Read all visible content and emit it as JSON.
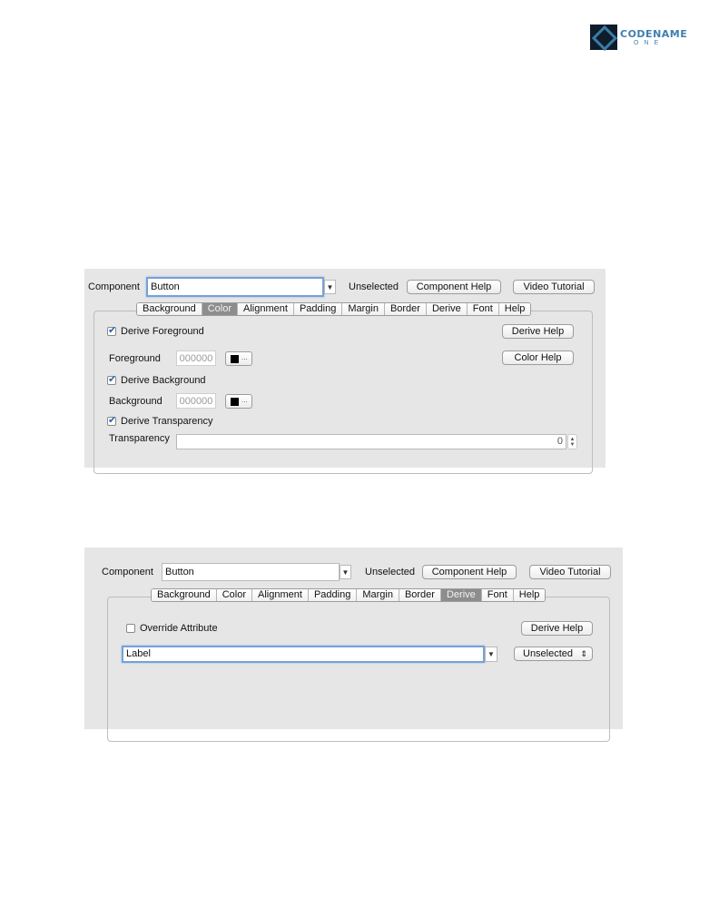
{
  "logo": {
    "title": "CODENAME",
    "subtitle": "ONE"
  },
  "panel1": {
    "component_label": "Component",
    "component_value": "Button",
    "status": "Unselected",
    "component_help": "Component Help",
    "video_tutorial": "Video Tutorial",
    "tabs": [
      "Background",
      "Color",
      "Alignment",
      "Padding",
      "Margin",
      "Border",
      "Derive",
      "Font",
      "Help"
    ],
    "active_tab": "Color",
    "derive_foreground": "Derive Foreground",
    "derive_help": "Derive Help",
    "foreground_label": "Foreground",
    "foreground_value": "000000",
    "color_help": "Color Help",
    "derive_background": "Derive Background",
    "background_label": "Background",
    "background_value": "000000",
    "derive_transparency": "Derive Transparency",
    "transparency_label": "Transparency",
    "transparency_value": "0",
    "ellipsis": "...",
    "dropdown_arrow": "▼",
    "spinner_up": "▲",
    "spinner_down": "▼"
  },
  "panel2": {
    "component_label": "Component",
    "component_value": "Button",
    "status": "Unselected",
    "component_help": "Component Help",
    "video_tutorial": "Video Tutorial",
    "tabs": [
      "Background",
      "Color",
      "Alignment",
      "Padding",
      "Margin",
      "Border",
      "Derive",
      "Font",
      "Help"
    ],
    "active_tab": "Derive",
    "override_attribute": "Override Attribute",
    "derive_help": "Derive Help",
    "derive_value": "Label",
    "state_select": "Unselected",
    "dropdown_arrow": "▼",
    "select_arrows": "⇕"
  }
}
